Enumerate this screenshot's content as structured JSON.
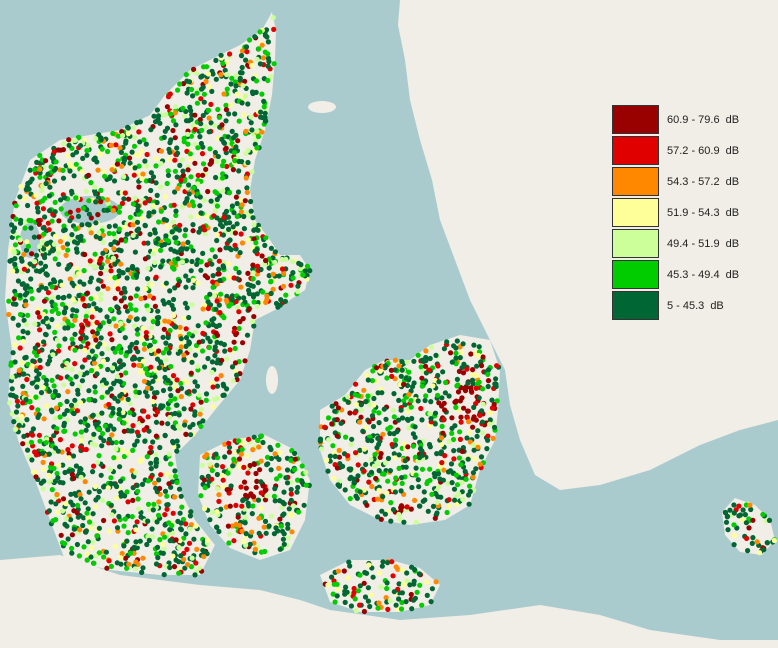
{
  "map": {
    "colors": {
      "sea": "#aacbcd",
      "land": "#f0eee6",
      "land_outline": "#d9d6cb"
    },
    "regions": [
      "Jutland",
      "Funen",
      "Zealand",
      "Lolland-Falster",
      "Bornholm",
      "Sweden"
    ],
    "dot_count_estimate": 5000
  },
  "legend": {
    "items": [
      {
        "label": "60.9 - 79.6",
        "unit": "dB",
        "color": "#990000"
      },
      {
        "label": "57.2 - 60.9",
        "unit": "dB",
        "color": "#e00000"
      },
      {
        "label": "54.3 - 57.2",
        "unit": "dB",
        "color": "#ff8800"
      },
      {
        "label": "51.9 - 54.3",
        "unit": "dB",
        "color": "#ffff99"
      },
      {
        "label": "49.4 - 51.9",
        "unit": "dB",
        "color": "#ccff99"
      },
      {
        "label": "45.3 - 49.4",
        "unit": "dB",
        "color": "#00cc00"
      },
      {
        "label": "5 - 45.3",
        "unit": "dB",
        "color": "#006633"
      }
    ]
  }
}
